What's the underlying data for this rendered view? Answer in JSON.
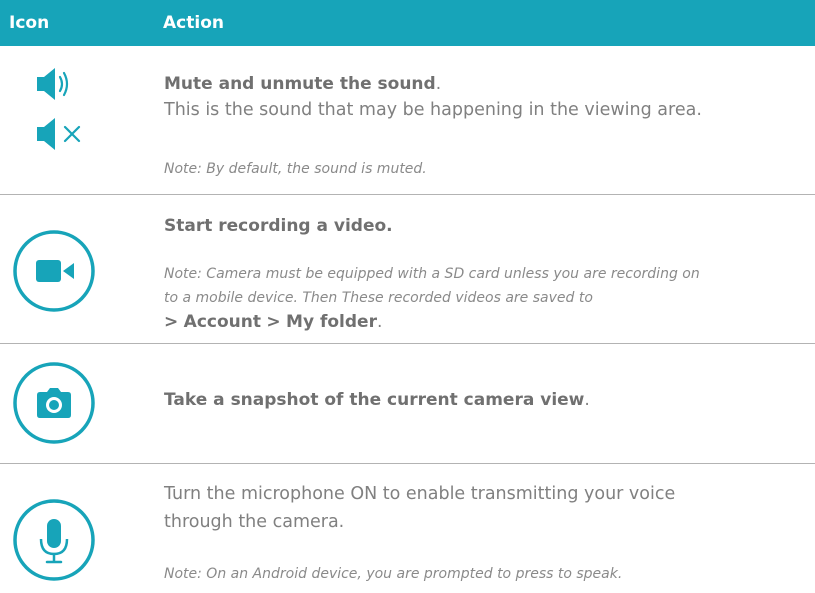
{
  "header": {
    "icon_label": "Icon",
    "action_label": "Action"
  },
  "rows": [
    {
      "icons": [
        "speaker-on-icon",
        "speaker-muted-icon"
      ],
      "title": "Mute and unmute the sound",
      "title_suffix": ".",
      "desc": "This is the sound that may be happening in the viewing area.",
      "note": "Note: By default, the sound is muted."
    },
    {
      "icons": [
        "video-camera-icon"
      ],
      "title": "Start recording a video.",
      "note_line1": "Note: Camera must be equipped with a SD card unless you are recording on",
      "note_line2": "to a mobile device. Then These recorded videos are saved to",
      "path_sep1": ">",
      "path_item1": "Account",
      "path_sep2": ">",
      "path_item2": "My folder",
      "path_end": "."
    },
    {
      "icons": [
        "camera-icon"
      ],
      "title": "Take a snapshot of the current camera view",
      "title_suffix": "."
    },
    {
      "icons": [
        "microphone-icon"
      ],
      "desc_line1": "Turn the microphone ON to enable transmitting your voice",
      "desc_line2": "through the camera.",
      "note": "Note: On an Android device, you are prompted to press to speak."
    }
  ],
  "colors": {
    "accent": "#17a4b9",
    "text": "#808080",
    "divider": "#b3b3b3"
  }
}
